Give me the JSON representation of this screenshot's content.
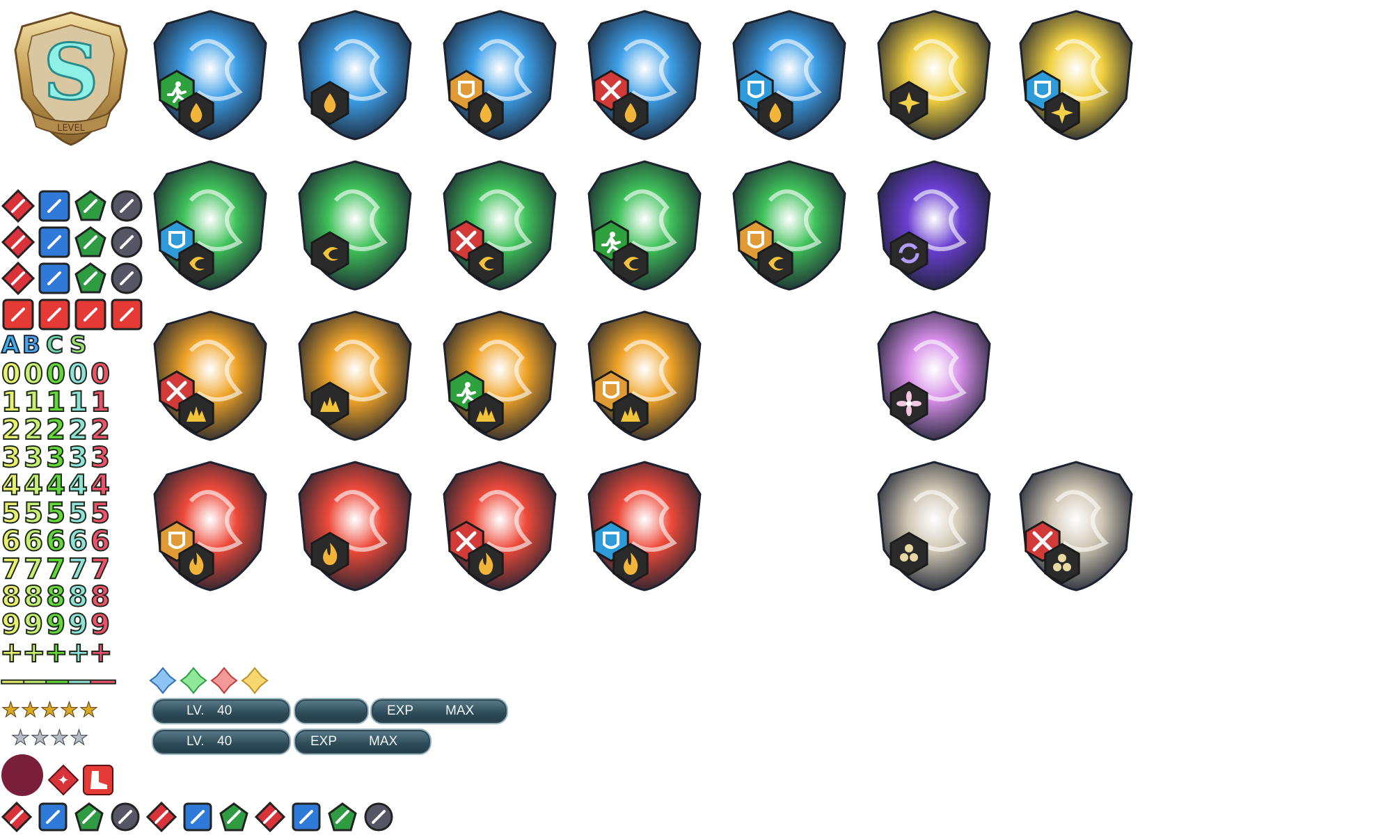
{
  "sheet": {
    "level_badge": {
      "letter": "S",
      "ribbon": "LEVEL"
    },
    "crest_rows": [
      {
        "element": "water",
        "icons": [
          [
            "move-icon",
            "water-icon"
          ],
          [
            "water-icon"
          ],
          [
            "armor-icon",
            "water-icon"
          ],
          [
            "attack-icon",
            "water-icon"
          ],
          [
            "defense-icon",
            "water-icon"
          ]
        ]
      },
      {
        "element": "wind",
        "icons": [
          [
            "defense-icon",
            "wind-icon"
          ],
          [
            "wind-icon"
          ],
          [
            "attack-icon",
            "wind-icon"
          ],
          [
            "move-icon",
            "wind-icon"
          ],
          [
            "armor-icon",
            "wind-icon"
          ]
        ]
      },
      {
        "element": "earth",
        "icons": [
          [
            "attack-icon",
            "earth-icon"
          ],
          [
            "earth-icon"
          ],
          [
            "move-icon",
            "earth-icon"
          ],
          [
            "armor-icon",
            "earth-icon"
          ]
        ]
      },
      {
        "element": "fire",
        "icons": [
          [
            "armor-icon",
            "fire-icon"
          ],
          [
            "fire-icon"
          ],
          [
            "attack-icon",
            "fire-icon"
          ],
          [
            "defense-icon",
            "fire-icon"
          ]
        ]
      }
    ],
    "special_crests": [
      {
        "element": "light",
        "icons": [
          "light-icon"
        ]
      },
      {
        "element": "light",
        "icons": [
          "defense-icon",
          "light-icon"
        ]
      },
      {
        "element": "dark",
        "icons": [
          "dark-icon"
        ]
      },
      {
        "element": "astral",
        "icons": [
          "flower-icon"
        ]
      },
      {
        "element": "anima",
        "icons": [
          "anima-icon"
        ]
      },
      {
        "element": "anima",
        "icons": [
          "attack-icon",
          "anima-icon"
        ]
      }
    ],
    "rank_letters": [
      "A",
      "B",
      "C",
      "S"
    ],
    "digits": [
      "0",
      "1",
      "2",
      "3",
      "4",
      "5",
      "6",
      "7",
      "8",
      "9",
      "+",
      "—"
    ],
    "level_bars": {
      "row1": {
        "lv_label": "LV.",
        "lv_value": "40",
        "exp_label": "EXP",
        "max_label": "MAX"
      },
      "row2": {
        "lv_label": "LV.",
        "lv_value": "40",
        "exp_label": "EXP",
        "max_label": "MAX"
      }
    },
    "stars": {
      "gold_count": 5,
      "silver_count": 4,
      "gold_glyph": "★",
      "silver_glyph": "★"
    },
    "colors": {
      "water": "#3d9fe8",
      "wind": "#3fc15a",
      "earth": "#f0a428",
      "fire": "#ee4a3a",
      "light": "#f1d040",
      "dark": "#6a3fd2",
      "astral": "#d68ee8",
      "anima": "#cfc6b3",
      "digit_colors": [
        "#e8f070",
        "#c8ee74",
        "#62d83a",
        "#8fe2d8",
        "#f05070"
      ]
    }
  }
}
